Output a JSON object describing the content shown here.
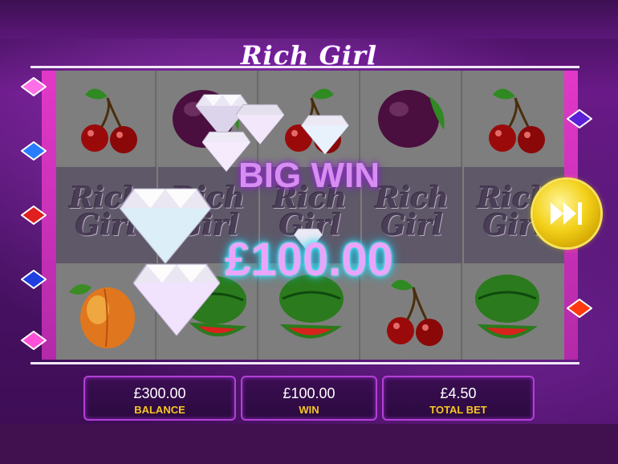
{
  "game": {
    "logo_text": "Rich Girl"
  },
  "reels": {
    "columns": [
      {
        "top": "cherry",
        "middle": "rich-girl-logo",
        "bottom": "peach"
      },
      {
        "top": "plum",
        "middle": "rich-girl-logo",
        "bottom": "watermelon"
      },
      {
        "top": "cherry",
        "middle": "rich-girl-logo",
        "bottom": "watermelon"
      },
      {
        "top": "plum",
        "middle": "rich-girl-logo",
        "bottom": "cherry"
      },
      {
        "top": "cherry",
        "middle": "rich-girl-logo",
        "bottom": "watermelon"
      }
    ],
    "tile_text": "Rich Girl"
  },
  "win_overlay": {
    "big_win_text": "BIG WIN",
    "amount": "£100.00"
  },
  "payline_markers": {
    "left": [
      "pink",
      "blue",
      "red",
      "blue",
      "pink"
    ],
    "right": [
      "purple",
      "yellow",
      "red"
    ]
  },
  "panel": {
    "balance_value": "£300.00",
    "balance_label": "BALANCE",
    "win_value": "£100.00",
    "win_label": "WIN",
    "total_bet_value": "£4.50",
    "total_bet_label": "TOTAL BET"
  },
  "colors": {
    "accent_gold": "#f7c625",
    "frame_pink": "#e238c8",
    "win_glow": "#2be6ff"
  }
}
